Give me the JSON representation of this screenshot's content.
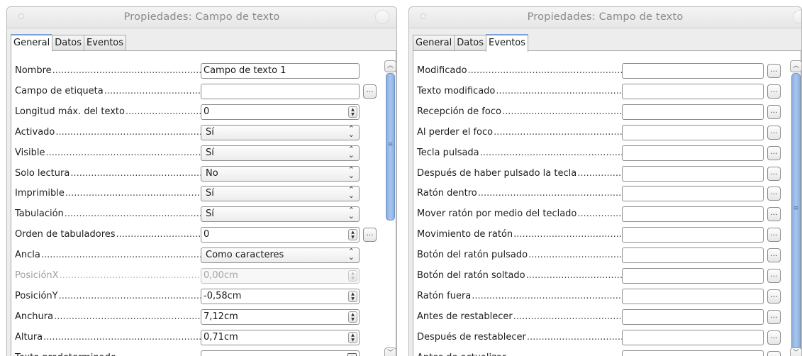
{
  "left_window": {
    "title": "Propiedades: Campo de texto",
    "tabs": [
      "General",
      "Datos",
      "Eventos"
    ],
    "active_tab": "General",
    "rows": [
      {
        "label": "Nombre",
        "type": "text",
        "value": "Campo de texto 1",
        "ellipsis": false
      },
      {
        "label": "Campo de etiqueta",
        "type": "text",
        "value": "",
        "ellipsis": true
      },
      {
        "label": "Longitud máx. del texto",
        "type": "spin",
        "value": "0",
        "ellipsis": false
      },
      {
        "label": "Activado",
        "type": "combo",
        "value": "Sí",
        "ellipsis": false
      },
      {
        "label": "Visible",
        "type": "combo",
        "value": "Sí",
        "ellipsis": false
      },
      {
        "label": "Solo lectura",
        "type": "combo",
        "value": "No",
        "ellipsis": false
      },
      {
        "label": "Imprimible",
        "type": "combo",
        "value": "Sí",
        "ellipsis": false
      },
      {
        "label": "Tabulación",
        "type": "combo",
        "value": "Sí",
        "ellipsis": false
      },
      {
        "label": "Orden de tabuladores",
        "type": "spin",
        "value": "0",
        "ellipsis": true
      },
      {
        "label": "Ancla",
        "type": "combo",
        "value": "Como caracteres",
        "ellipsis": false
      },
      {
        "label": "PosiciónX",
        "type": "spin",
        "value": "0,00cm",
        "disabled": true,
        "ellipsis": false
      },
      {
        "label": "PosiciónY",
        "type": "spin",
        "value": "-0,58cm",
        "ellipsis": false
      },
      {
        "label": "Anchura",
        "type": "spin",
        "value": "7,12cm",
        "ellipsis": false
      },
      {
        "label": "Altura",
        "type": "spin",
        "value": "0,71cm",
        "ellipsis": false
      },
      {
        "label": "Texto predeterminado",
        "type": "dropdown",
        "value": "",
        "ellipsis": false
      }
    ]
  },
  "right_window": {
    "title": "Propiedades: Campo de texto",
    "tabs": [
      "General",
      "Datos",
      "Eventos"
    ],
    "active_tab": "Eventos",
    "rows": [
      {
        "label": "Modificado",
        "value": ""
      },
      {
        "label": "Texto modificado",
        "value": ""
      },
      {
        "label": "Recepción de foco",
        "value": ""
      },
      {
        "label": "Al perder el foco",
        "value": ""
      },
      {
        "label": "Tecla pulsada",
        "value": ""
      },
      {
        "label": "Después de haber pulsado la tecla",
        "value": ""
      },
      {
        "label": "Ratón dentro",
        "value": ""
      },
      {
        "label": "Mover ratón por medio del teclado",
        "value": ""
      },
      {
        "label": "Movimiento de ratón",
        "value": ""
      },
      {
        "label": "Botón del ratón pulsado",
        "value": ""
      },
      {
        "label": "Botón del ratón soltado",
        "value": ""
      },
      {
        "label": "Ratón fuera",
        "value": ""
      },
      {
        "label": "Antes de restablecer",
        "value": ""
      },
      {
        "label": "Después de restablecer",
        "value": ""
      },
      {
        "label": "Antes de actualizar",
        "value": ""
      }
    ]
  },
  "icons": {
    "ellipsis_button": "…",
    "scroll_up": "arrow-up-icon",
    "scroll_down": "arrow-down-icon",
    "combo": "updown-chevron-icon",
    "spin": "spin-arrows-icon"
  },
  "colors": {
    "accent": "#8ab0e0",
    "tab_active_border": "#7aa0d4"
  }
}
